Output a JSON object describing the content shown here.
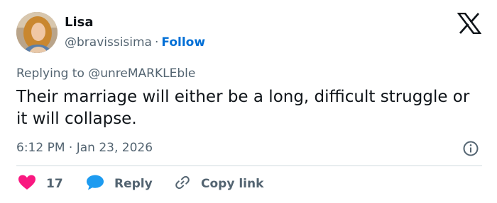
{
  "author": {
    "name": "Lisa",
    "handle": "@bravissisima",
    "separator": "·",
    "follow_label": "Follow"
  },
  "replying": {
    "prefix": "Replying to ",
    "mention": "@unreMARKLEble"
  },
  "tweet": {
    "text": "Their marriage will either be a long, difficult struggle or it will collapse.",
    "timestamp": "6:12 PM · Jan 23, 2026"
  },
  "actions": {
    "like_count": "17",
    "reply_label": "Reply",
    "copy_label": "Copy link"
  },
  "colors": {
    "like": "#f91880",
    "reply": "#1d9bf0",
    "follow": "#006fd6",
    "secondary_text": "#536471"
  },
  "icons": {
    "brand": "x-logo-icon",
    "info": "info-icon",
    "like": "heart-icon",
    "reply": "speech-bubble-icon",
    "copy": "link-icon"
  }
}
